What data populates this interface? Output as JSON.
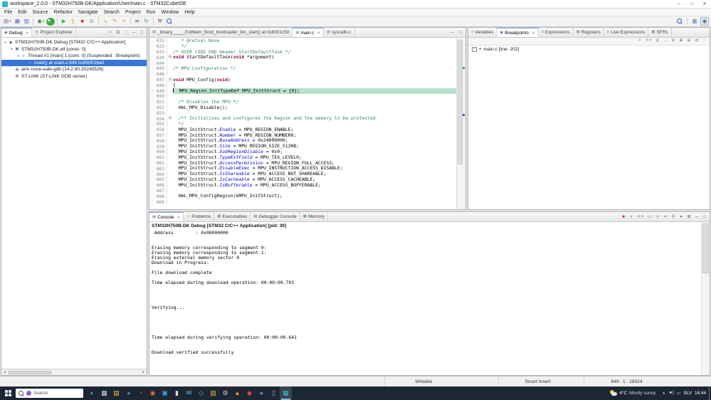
{
  "window": {
    "title": "workspace_2.0.0 - STM32H750B-DK/Application/User/main.c - STM32CubeIDE",
    "controls": [
      {
        "name": "minimize-button",
        "glyph": "─"
      },
      {
        "name": "maximize-button",
        "glyph": "□"
      },
      {
        "name": "close-button",
        "glyph": "✕"
      }
    ]
  },
  "menu": {
    "items": [
      "File",
      "Edit",
      "Source",
      "Refactor",
      "Navigate",
      "Search",
      "Project",
      "Run",
      "Window",
      "Help"
    ]
  },
  "toolbar": {
    "items": [
      {
        "name": "new-wizard-icon",
        "glyph": "▤",
        "color": "#7a5cab",
        "caret": true
      },
      {
        "name": "save-icon",
        "glyph": "▦",
        "color": "#4a5fc1"
      },
      {
        "name": "save-all-icon",
        "glyph": "▥",
        "color": "#4a5fc1"
      },
      {
        "sep": true
      },
      {
        "name": "debug-icon",
        "glyph": "◉",
        "color": "#3f7d3f",
        "caret": true
      },
      {
        "name": "run-icon",
        "glyph": "▶",
        "color": "#ffffff",
        "bg": "#3fae49",
        "caret": true
      },
      {
        "sep": true
      },
      {
        "name": "resume-icon",
        "glyph": "▶",
        "color": "#3fae49"
      },
      {
        "name": "suspend-icon",
        "glyph": "||",
        "color": "#c8a020"
      },
      {
        "name": "terminate-icon",
        "glyph": "■",
        "color": "#c03a2b"
      },
      {
        "name": "disconnect-icon",
        "glyph": "⊘",
        "color": "#8a8a8a"
      },
      {
        "sep": true
      },
      {
        "name": "step-into-icon",
        "glyph": "↘",
        "color": "#c8a020"
      },
      {
        "name": "step-over-icon",
        "glyph": "↷",
        "color": "#c8a020"
      },
      {
        "name": "step-return-icon",
        "glyph": "↗",
        "color": "#c8a020"
      },
      {
        "sep": true
      },
      {
        "name": "instruction-stepping-icon",
        "glyph": "≫",
        "color": "#6a6a6a"
      },
      {
        "name": "restart-icon",
        "glyph": "↻",
        "color": "#2f8f6f"
      },
      {
        "sep": true
      },
      {
        "name": "build-icon",
        "glyph": "⚒",
        "color": "#7a5c2e"
      },
      {
        "name": "search-icon",
        "mag": true
      }
    ],
    "right": [
      {
        "name": "quick-access-search-icon",
        "mag": true
      },
      {
        "sep": true
      },
      {
        "name": "perspective-cpp-icon",
        "glyph": "▦",
        "color": "#5b7db1"
      },
      {
        "name": "perspective-debug-icon",
        "glyph": "◉",
        "color": "#3f7d3f",
        "active": true
      }
    ]
  },
  "debug_view": {
    "tabs": [
      {
        "label": "Debug",
        "active": true,
        "closable": true,
        "glyph": "◉",
        "iconColor": "#3f7d3f"
      },
      {
        "label": "Project Explorer",
        "glyph": "▤",
        "iconColor": "#b8923a"
      }
    ],
    "toolbar": [
      {
        "name": "remove-all-terminated-icon",
        "glyph": "✕",
        "color": "#8a8a8a"
      },
      {
        "name": "collapse-all-icon",
        "glyph": "⊟",
        "color": "#556677"
      },
      {
        "name": "view-menu-icon",
        "glyph": "⋮",
        "color": "#556677"
      },
      {
        "name": "minimize-view-icon",
        "glyph": "─",
        "color": "#555555"
      },
      {
        "name": "maximize-view-icon",
        "glyph": "□",
        "color": "#555555"
      }
    ],
    "tree": [
      {
        "indent": 0,
        "exp": "▾",
        "name": "launch-target",
        "glyph": "◆",
        "color": "#3a7d44",
        "label": "STM32H750B-DK Debug [STM32 C/C++ Application]"
      },
      {
        "indent": 1,
        "exp": "▾",
        "name": "program",
        "glyph": "▣",
        "color": "#3a6ea5",
        "label": "STM32H750B-DK.elf [cores: 0]"
      },
      {
        "indent": 2,
        "exp": "▾",
        "name": "thread",
        "glyph": "≡",
        "color": "#4a7d3a",
        "label": "Thread #1 [main] 1 [core: 0] (Suspended : Breakpoint)"
      },
      {
        "indent": 3,
        "exp": "",
        "name": "stack-frame",
        "glyph": "→",
        "color": "#e8c13a",
        "label": "main() at main.c:649 0x900016a0",
        "selected": true
      },
      {
        "indent": 1,
        "exp": "",
        "name": "gdb-process",
        "glyph": "▣",
        "color": "#888888",
        "label": "arm-none-eabi-gdb (14.2.90.20240526)"
      },
      {
        "indent": 1,
        "exp": "",
        "name": "gdb-server",
        "glyph": "▣",
        "color": "#888888",
        "label": "ST-LINK (ST-LINK GDB server)"
      }
    ],
    "scroll_left": "◂",
    "scroll_right": "▸"
  },
  "editor": {
    "tabs": [
      {
        "label": "_binary_____ExtMem_Boot_bootloader_bin_start() at 0x8001c50",
        "glyph": "▤",
        "iconColor": "#5b7db1"
      },
      {
        "label": "main.c",
        "active": true,
        "closable": true,
        "glyph": "▤",
        "iconColor": "#5b7db1"
      },
      {
        "label": "syscalls.c",
        "glyph": "▤",
        "iconColor": "#5b7db1"
      }
    ],
    "toolbar": [
      {
        "name": "minimize-view-icon",
        "glyph": "─",
        "color": "#555555"
      },
      {
        "name": "maximize-view-icon",
        "glyph": "□",
        "color": "#555555"
      }
    ],
    "current_line": 649,
    "lines": [
      {
        "n": "631",
        "s": [
          [
            "   * @retval None",
            "c"
          ]
        ]
      },
      {
        "n": "632",
        "s": [
          [
            "   */",
            "c"
          ]
        ]
      },
      {
        "n": "633",
        "s": [
          [
            "/* USER CODE END Header_StartDefaultTask */",
            "c"
          ]
        ]
      },
      {
        "n": "634",
        "fold": "⊞",
        "s": [
          [
            "void",
            "k"
          ],
          [
            " StartDefaultTask(",
            "p"
          ],
          [
            "void",
            "k"
          ],
          [
            " *argument)",
            "p"
          ]
        ]
      },
      {
        "n": "644",
        "s": []
      },
      {
        "n": "645",
        "s": [
          [
            "/* MPU Configuration */",
            "c"
          ]
        ]
      },
      {
        "n": "646",
        "s": []
      },
      {
        "n": "647",
        "fold": "⊟",
        "s": [
          [
            "void",
            "k"
          ],
          [
            " MPU_Config(",
            "p"
          ],
          [
            "void",
            "k"
          ],
          [
            ")",
            "p"
          ]
        ]
      },
      {
        "n": "648",
        "s": [
          [
            "{",
            "p"
          ]
        ]
      },
      {
        "n": "649",
        "hl": true,
        "marker": true,
        "caret": true,
        "s": [
          [
            "  MPU_Region_InitTypeDef MPU_InitStruct = {0};",
            "p"
          ]
        ]
      },
      {
        "n": "650",
        "s": []
      },
      {
        "n": "651",
        "s": [
          [
            "  /* Disables the MPU */",
            "c"
          ]
        ]
      },
      {
        "n": "652",
        "s": [
          [
            "  HAL_MPU_Disable();",
            "p"
          ]
        ]
      },
      {
        "n": "653",
        "s": []
      },
      {
        "n": "654",
        "fold": "⊟",
        "s": [
          [
            "  /** Initializes and configures the Region and the memory to be protected",
            "c"
          ]
        ]
      },
      {
        "n": "655",
        "s": [
          [
            "  */",
            "c"
          ]
        ]
      },
      {
        "n": "656",
        "s": [
          [
            "  MPU_InitStruct.",
            "p"
          ],
          [
            "Enable",
            "f"
          ],
          [
            " = MPU_REGION_ENABLE;",
            "p"
          ]
        ]
      },
      {
        "n": "657",
        "s": [
          [
            "  MPU_InitStruct.",
            "p"
          ],
          [
            "Number",
            "f"
          ],
          [
            " = MPU_REGION_NUMBER0;",
            "p"
          ]
        ]
      },
      {
        "n": "658",
        "s": [
          [
            "  MPU_InitStruct.",
            "p"
          ],
          [
            "BaseAddress",
            "f"
          ],
          [
            " = 0x24000000;",
            "p"
          ]
        ]
      },
      {
        "n": "659",
        "s": [
          [
            "  MPU_InitStruct.",
            "p"
          ],
          [
            "Size",
            "f"
          ],
          [
            " = MPU_REGION_SIZE_512KB;",
            "p"
          ]
        ]
      },
      {
        "n": "660",
        "s": [
          [
            "  MPU_InitStruct.",
            "p"
          ],
          [
            "SubRegionDisable",
            "f"
          ],
          [
            " = 0x0;",
            "p"
          ]
        ]
      },
      {
        "n": "661",
        "s": [
          [
            "  MPU_InitStruct.",
            "p"
          ],
          [
            "TypeExtField",
            "f"
          ],
          [
            " = MPU_TEX_LEVEL0;",
            "p"
          ]
        ]
      },
      {
        "n": "662",
        "s": [
          [
            "  MPU_InitStruct.",
            "p"
          ],
          [
            "AccessPermission",
            "f"
          ],
          [
            " = MPU_REGION_FULL_ACCESS;",
            "p"
          ]
        ]
      },
      {
        "n": "663",
        "s": [
          [
            "  MPU_InitStruct.",
            "p"
          ],
          [
            "DisableExec",
            "f"
          ],
          [
            " = MPU_INSTRUCTION_ACCESS_DISABLE;",
            "p"
          ]
        ]
      },
      {
        "n": "664",
        "s": [
          [
            "  MPU_InitStruct.",
            "p"
          ],
          [
            "IsShareable",
            "f"
          ],
          [
            " = MPU_ACCESS_NOT_SHAREABLE;",
            "p"
          ]
        ]
      },
      {
        "n": "665",
        "s": [
          [
            "  MPU_InitStruct.",
            "p"
          ],
          [
            "IsCacheable",
            "f"
          ],
          [
            " = MPU_ACCESS_CACHEABLE;",
            "p"
          ]
        ]
      },
      {
        "n": "666",
        "s": [
          [
            "  MPU_InitStruct.",
            "p"
          ],
          [
            "IsBufferable",
            "f"
          ],
          [
            " = MPU_ACCESS_BUFFERABLE;",
            "p"
          ]
        ]
      },
      {
        "n": "667",
        "s": []
      },
      {
        "n": "668",
        "s": [
          [
            "  HAL_MPU_ConfigRegion(&MPU_InitStruct);",
            "p"
          ]
        ]
      },
      {
        "n": "669",
        "s": []
      }
    ]
  },
  "breakpoints_view": {
    "tabs": [
      {
        "label": "Variables",
        "glyph": "≡",
        "iconColor": "#b8860b"
      },
      {
        "label": "Breakpoints",
        "active": true,
        "closable": true,
        "glyph": "◉",
        "iconColor": "#2a66c8"
      },
      {
        "label": "Expressions",
        "glyph": "≡",
        "iconColor": "#2a66c8"
      },
      {
        "label": "Registers",
        "glyph": "▦",
        "iconColor": "#888888"
      },
      {
        "label": "Live Expressions",
        "glyph": "≡",
        "iconColor": "#3f7d3f"
      },
      {
        "label": "SFRs",
        "glyph": "▦",
        "iconColor": "#5b7db1"
      }
    ],
    "toolbar": [
      {
        "name": "remove-breakpoint-icon",
        "glyph": "✕",
        "color": "#8a8a8a"
      },
      {
        "name": "remove-all-breakpoints-icon",
        "glyph": "✕✕",
        "color": "#8a8a8a"
      },
      {
        "name": "show-supported-breakpoints-icon",
        "glyph": "◎",
        "color": "#556677"
      },
      {
        "name": "goto-file-icon",
        "glyph": "→",
        "color": "#556677"
      },
      {
        "name": "skip-all-breakpoints-icon",
        "glyph": "⊘",
        "color": "#556677"
      },
      {
        "name": "expand-all-icon",
        "glyph": "⊞",
        "color": "#556677"
      },
      {
        "name": "collapse-all-icon",
        "glyph": "⊟",
        "color": "#556677"
      },
      {
        "name": "link-with-debug-icon",
        "glyph": "⇄",
        "color": "#556677"
      },
      {
        "name": "view-menu-icon",
        "glyph": "⋮",
        "color": "#556677"
      }
    ],
    "items": [
      {
        "checked": true,
        "check_glyph": "✓",
        "icon_glyph": "●",
        "icon_color": "#2a66c8",
        "label": "main.c [line: 202]"
      }
    ]
  },
  "console_view": {
    "tabs": [
      {
        "label": "Console",
        "active": true,
        "closable": true,
        "glyph": "▤",
        "iconColor": "#556677"
      },
      {
        "label": "Problems",
        "glyph": "⚠",
        "iconColor": "#c8a020"
      },
      {
        "label": "Executables",
        "glyph": "▦",
        "iconColor": "#5b7db1"
      },
      {
        "label": "Debugger Console",
        "glyph": "▤",
        "iconColor": "#556677"
      },
      {
        "label": "Memory",
        "glyph": "▦",
        "iconColor": "#2f8f6f"
      }
    ],
    "toolbar": [
      {
        "name": "terminate-console-icon",
        "glyph": "■",
        "color": "#c03a2b"
      },
      {
        "name": "remove-launch-icon",
        "glyph": "✕",
        "color": "#8a8a8a"
      },
      {
        "name": "remove-all-launches-icon",
        "glyph": "✕✕",
        "color": "#8a8a8a"
      },
      {
        "name": "clear-console-icon",
        "glyph": "▭",
        "color": "#556677"
      },
      {
        "name": "scroll-lock-icon",
        "glyph": "⇩",
        "color": "#556677"
      },
      {
        "name": "word-wrap-icon",
        "glyph": "↩",
        "color": "#556677"
      },
      {
        "name": "pin-console-icon",
        "glyph": "⊼",
        "color": "#556677"
      },
      {
        "name": "display-selected-console-icon",
        "glyph": "▾",
        "color": "#556677"
      },
      {
        "name": "open-console-icon",
        "glyph": "⊞",
        "color": "#556677"
      },
      {
        "name": "minimize-view-icon",
        "glyph": "─",
        "color": "#555555"
      },
      {
        "name": "maximize-view-icon",
        "glyph": "□",
        "color": "#555555"
      }
    ],
    "title": "STM32H750B-DK Debug [STM32 C/C++ Application] [pid: 39]",
    "lines": [
      " Address        : 0x08000000",
      "",
      "",
      "Erasing memory corresponding to segment 0:",
      "Erasing memory corresponding to segment 1:",
      "Erasing external memory sector 0",
      "Download in Progress:",
      "",
      "File download complete",
      "",
      "Time elapsed during download operation: 00:00:09.793",
      "",
      "",
      "",
      "",
      "Verifying...",
      "",
      "",
      "",
      "",
      "",
      "Time elapsed during verifying operation: 00:00:00.641",
      "",
      "",
      "Download verified successfully"
    ]
  },
  "status_bar": {
    "writable": "Writable",
    "insert_mode": "Smart Insert",
    "position": "649 : 1 : 18024"
  },
  "taskbar": {
    "search_placeholder": "Search",
    "apps": [
      {
        "name": "copilot",
        "glyph": "◐",
        "color": "#58c4dd"
      },
      {
        "name": "task-view",
        "glyph": "▦",
        "color": "#cfd8e3"
      },
      {
        "name": "file-explorer",
        "glyph": "▤",
        "color": "#f2c14e"
      },
      {
        "name": "edge",
        "glyph": "◕",
        "color": "#3aa7dd"
      },
      {
        "name": "chrome",
        "glyph": "◔",
        "color": "#e04f3f"
      },
      {
        "name": "firefox",
        "glyph": "◉",
        "color": "#f0702a"
      },
      {
        "name": "vscode",
        "glyph": "▣",
        "color": "#3aa0e8"
      },
      {
        "name": "terminal",
        "glyph": "▮",
        "color": "#d8dde6"
      },
      {
        "name": "mail",
        "glyph": "✉",
        "color": "#6db3e8"
      },
      {
        "name": "store",
        "glyph": "◇",
        "color": "#58b4e8"
      },
      {
        "name": "photos",
        "glyph": "▨",
        "color": "#e8b23a"
      },
      {
        "name": "settings",
        "glyph": "⚙",
        "color": "#c8ccd4"
      },
      {
        "name": "vlc",
        "glyph": "▲",
        "color": "#f08a1d"
      },
      {
        "name": "git-client",
        "glyph": "◆",
        "color": "#e04848"
      },
      {
        "name": "teams",
        "glyph": "●",
        "color": "#7289da"
      },
      {
        "name": "notepad",
        "glyph": "▯",
        "color": "#9fb4c8"
      },
      {
        "name": "stm32cubeide",
        "glyph": "▦",
        "color": "#35b8c8",
        "active": true
      }
    ],
    "weather": {
      "temp": "4°C",
      "condition": "Mostly sunny"
    },
    "tray": {
      "icons": [
        {
          "name": "tray-expand-icon",
          "glyph": "∧"
        },
        {
          "name": "volume-icon",
          "glyph": "◄)"
        },
        {
          "name": "keyboard-icon",
          "glyph": "▭"
        }
      ],
      "lang": "SLV",
      "time": "16:44"
    }
  },
  "colors": {
    "accent": "#2a66c8",
    "selection": "#3875d6",
    "current_line_highlight": "#b5e0cb",
    "keyword": "#7f0055",
    "comment": "#3f7f5f",
    "field": "#0000c0",
    "taskbar_bg": "#1d2733"
  }
}
